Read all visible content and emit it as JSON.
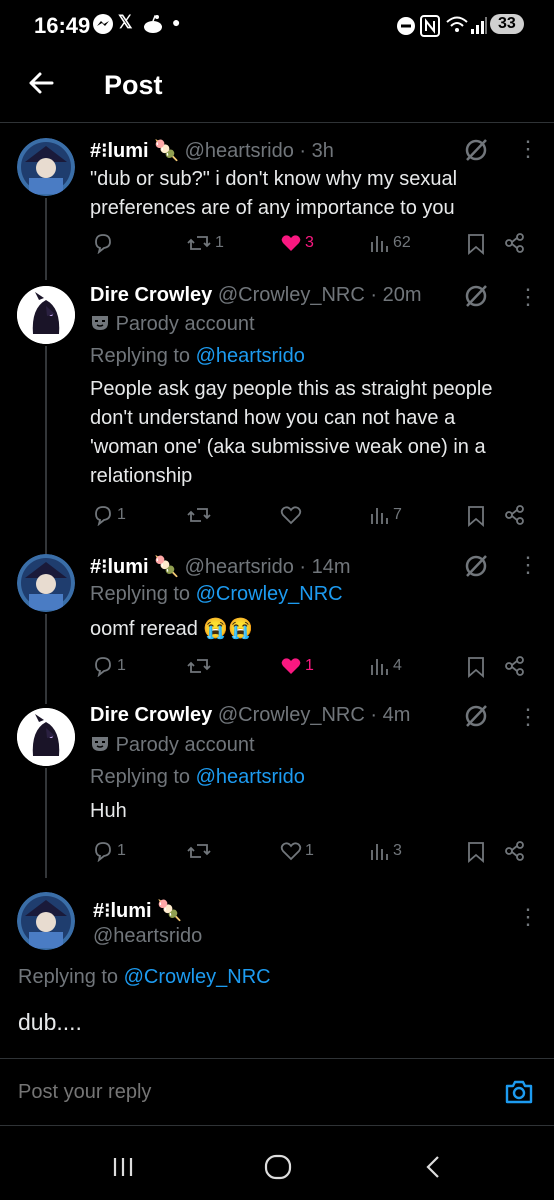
{
  "status_bar": {
    "time": "16:49",
    "battery": "33"
  },
  "header": {
    "title": "Post"
  },
  "tweets": [
    {
      "name": "#⁝lumi",
      "handle": "@heartsrido",
      "time": "3h",
      "text_lines": [
        "\"dub or sub?\" i don't know why my sexual",
        "preferences are of any importance to you"
      ],
      "replies": "",
      "reposts": "1",
      "likes": "3",
      "views": "62"
    },
    {
      "name": "Dire Crowley",
      "handle": "@Crowley_NRC",
      "time": "20m",
      "parody": "Parody account",
      "replying_label": "Replying to",
      "replying_to": "@heartsrido",
      "text_lines": [
        "People ask gay people this as straight people",
        "don't understand how you can not have a",
        "'woman one' (aka submissive weak one) in a",
        "relationship"
      ],
      "replies": "1",
      "reposts": "",
      "likes": "",
      "views": "7"
    },
    {
      "name": "#⁝lumi",
      "handle": "@heartsrido",
      "time": "14m",
      "replying_label": "Replying to",
      "replying_to": "@Crowley_NRC",
      "text": "oomf reread",
      "emoji": "😭😭",
      "replies": "1",
      "reposts": "",
      "likes": "1",
      "views": "4"
    },
    {
      "name": "Dire Crowley",
      "handle": "@Crowley_NRC",
      "time": "4m",
      "parody": "Parody account",
      "replying_label": "Replying to",
      "replying_to": "@heartsrido",
      "text": "Huh",
      "replies": "1",
      "reposts": "",
      "likes": "1",
      "views": "3"
    }
  ],
  "main_post": {
    "name": "#⁝lumi",
    "handle": "@heartsrido",
    "replying_label": "Replying to",
    "replying_to": "@Crowley_NRC",
    "text": "dub...."
  },
  "reply_box": {
    "placeholder": "Post your reply"
  },
  "colors": {
    "background": "#000000",
    "link": "#1d9bf0",
    "like_pink": "#f91880",
    "secondary_text": "#71767b"
  }
}
